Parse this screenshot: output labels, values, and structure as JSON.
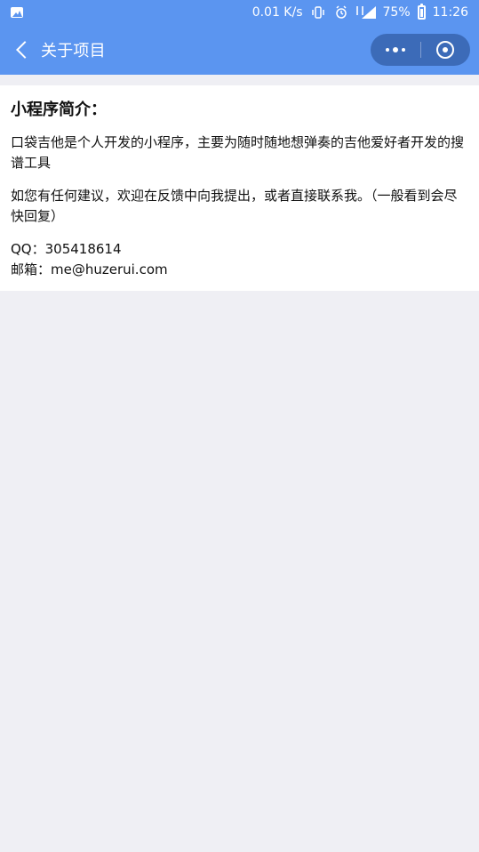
{
  "status_bar": {
    "network_speed": "0.01 K/s",
    "battery": "75%",
    "time": "11:26",
    "icons": [
      "gallery-icon",
      "vibrate-icon",
      "alarm-icon",
      "signal-icon",
      "battery-icon"
    ]
  },
  "nav": {
    "title": "关于项目",
    "back_icon": "back-chevron-icon",
    "more_icon": "more-dots-icon",
    "target_icon": "target-icon"
  },
  "content": {
    "heading": "小程序简介：",
    "paragraph_1": "口袋吉他是个人开发的小程序，主要为随时随地想弹奏的吉他爱好者开发的搜谱工具",
    "paragraph_2": "如您有任何建议，欢迎在反馈中向我提出，或者直接联系我。（一般看到会尽快回复）",
    "qq": "QQ：305418614",
    "email": "邮箱：me@huzerui.com"
  },
  "colors": {
    "topbar": "#5b95f0",
    "page_background": "#efeff4",
    "card_background": "#ffffff",
    "text": "#111111"
  }
}
